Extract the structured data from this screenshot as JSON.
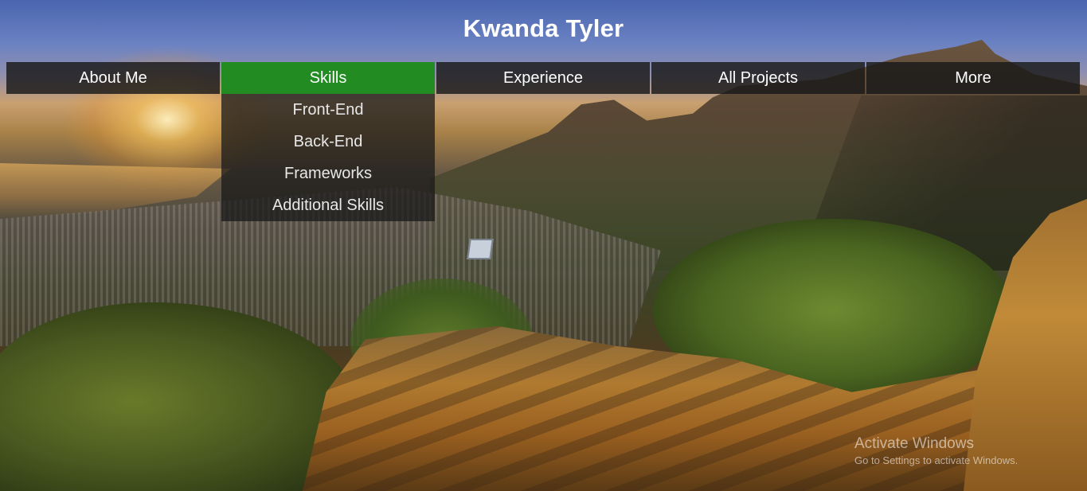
{
  "header": {
    "title": "Kwanda Tyler"
  },
  "nav": {
    "items": [
      {
        "label": "About Me"
      },
      {
        "label": "Skills"
      },
      {
        "label": "Experience"
      },
      {
        "label": "All Projects"
      },
      {
        "label": "More"
      }
    ],
    "active_item": "Skills",
    "active_color": "#228b22",
    "skills_dropdown": [
      {
        "label": "Front-End"
      },
      {
        "label": "Back-End"
      },
      {
        "label": "Frameworks"
      },
      {
        "label": "Additional Skills"
      }
    ]
  },
  "background": {
    "description_icon": "landscape-background-image"
  },
  "watermark": {
    "title": "Activate Windows",
    "subtitle": "Go to Settings to activate Windows."
  }
}
